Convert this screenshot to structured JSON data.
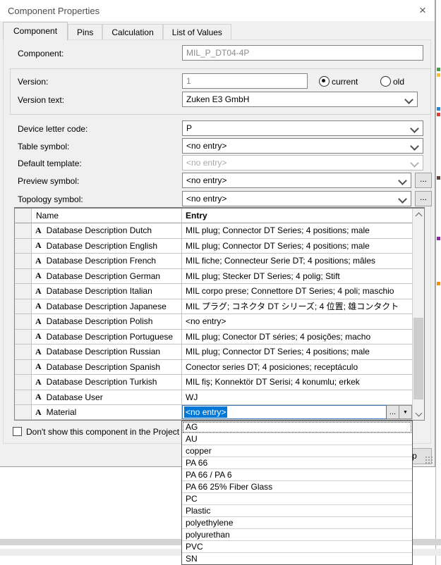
{
  "window": {
    "title": "Component Properties",
    "close_glyph": "×"
  },
  "tabs": [
    {
      "label": "Component"
    },
    {
      "label": "Pins"
    },
    {
      "label": "Calculation"
    },
    {
      "label": "List of Values"
    }
  ],
  "form": {
    "component_label": "Component:",
    "component_value": "MIL_P_DT04-4P",
    "version_label": "Version:",
    "version_value": "1",
    "radio_current_label": "current",
    "radio_old_label": "old",
    "version_text_label": "Version text:",
    "version_text_value": "Zuken E3 GmbH",
    "device_letter_label": "Device letter code:",
    "device_letter_value": "P",
    "table_symbol_label": "Table symbol:",
    "table_symbol_value": "<no entry>",
    "default_template_label": "Default template:",
    "default_template_value": "<no entry>",
    "preview_symbol_label": "Preview symbol:",
    "preview_symbol_value": "<no entry>",
    "preview_more_label": "...",
    "topology_symbol_label": "Topology symbol:",
    "topology_symbol_value": "<no entry>",
    "topology_more_label": "..."
  },
  "table": {
    "col_name": "Name",
    "col_entry": "Entry",
    "attr_icon": "A",
    "rows": [
      {
        "name": "Database Description Dutch",
        "entry": "MIL plug; Connector DT Series; 4 positions; male"
      },
      {
        "name": "Database Description English",
        "entry": "MIL plug; Connector DT Series; 4 positions; male"
      },
      {
        "name": "Database Description French",
        "entry": "MIL fiche; Connecteur Serie DT; 4 positions; mâles"
      },
      {
        "name": "Database Description German",
        "entry": "MIL plug; Stecker DT Series; 4 polig; Stift"
      },
      {
        "name": "Database Description Italian",
        "entry": "MIL corpo prese; Connettore DT Series; 4 poli; maschio"
      },
      {
        "name": "Database Description Japanese",
        "entry": "MIL プラグ; コネクタ DT シリーズ; 4 位置; 雄コンタクト"
      },
      {
        "name": "Database Description Polish",
        "entry": "<no entry>"
      },
      {
        "name": "Database Description Portuguese",
        "entry": "MIL plug; Conector DT séries; 4 posições; macho"
      },
      {
        "name": "Database Description Russian",
        "entry": "MIL plug; Connector DT Series; 4 positions; male"
      },
      {
        "name": "Database Description Spanish",
        "entry": "Conector series DT; 4 posiciones; receptáculo"
      },
      {
        "name": "Database Description Turkish",
        "entry": "MIL fiş; Konnektör DT Serisi; 4 konumlu; erkek"
      },
      {
        "name": "Database User",
        "entry": "WJ"
      }
    ],
    "material": {
      "name": "Material",
      "value": "<no entry>",
      "more_label": "...",
      "drop_glyph": "▼"
    }
  },
  "material_dropdown": {
    "options": [
      "AG",
      "AU",
      "copper",
      "PA 66",
      "PA 66 / PA 6",
      "PA 66 25% Fiber Glass",
      "PC",
      "Plastic",
      "polyethylene",
      "polyurethan",
      "PVC",
      "SN"
    ]
  },
  "footer": {
    "checkbox_label": "Don't show this component in the Project Database",
    "help_label": "Help"
  },
  "colors": {
    "selection": "#0078d7",
    "dialog_bg": "#f0f0f0"
  }
}
